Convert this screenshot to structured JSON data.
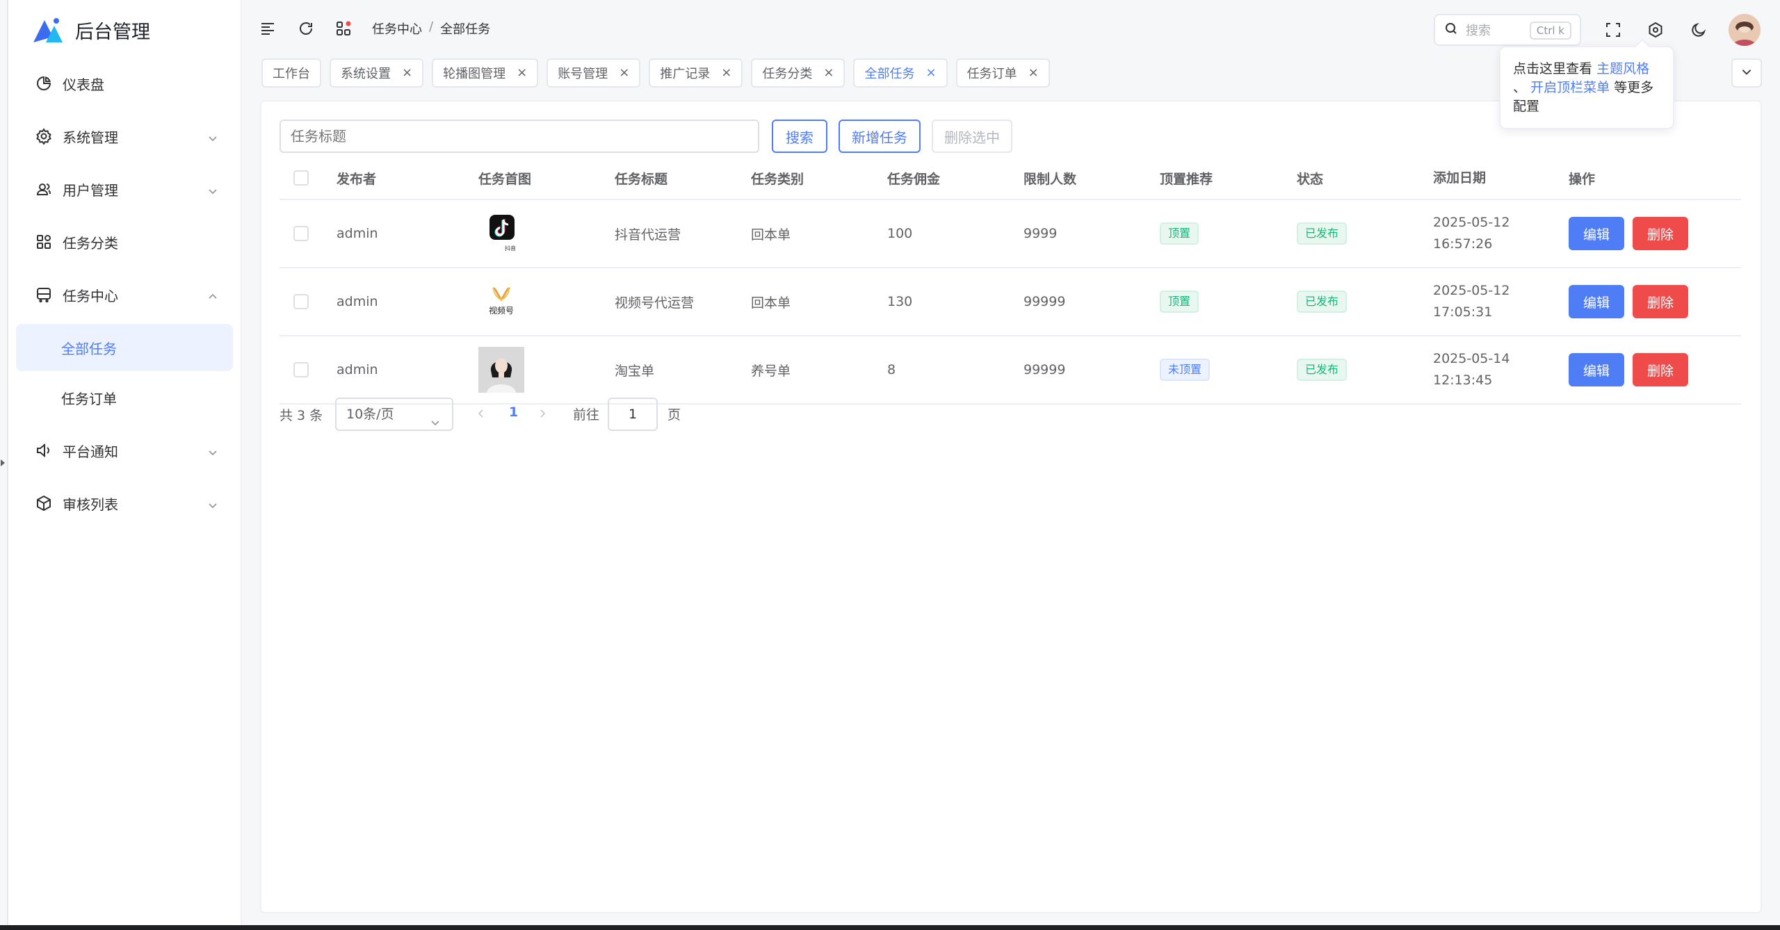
{
  "app": {
    "title": "后台管理"
  },
  "sidebar": {
    "items": [
      {
        "label": "仪表盘",
        "icon": "pie-chart-icon"
      },
      {
        "label": "系统管理",
        "icon": "gear-icon"
      },
      {
        "label": "用户管理",
        "icon": "users-icon"
      },
      {
        "label": "任务分类",
        "icon": "grid-icon"
      },
      {
        "label": "任务中心",
        "icon": "bus-icon"
      },
      {
        "label": "平台通知",
        "icon": "speaker-icon"
      },
      {
        "label": "审核列表",
        "icon": "box-icon"
      }
    ],
    "subitems": [
      {
        "label": "全部任务",
        "active": true
      },
      {
        "label": "任务订单",
        "active": false
      }
    ]
  },
  "header": {
    "breadcrumb": [
      "任务中心",
      "全部任务"
    ],
    "search_placeholder": "搜索",
    "search_shortcut": "Ctrl k"
  },
  "tabs": [
    {
      "label": "工作台",
      "closable": false
    },
    {
      "label": "系统设置",
      "closable": true
    },
    {
      "label": "轮播图管理",
      "closable": true
    },
    {
      "label": "账号管理",
      "closable": true
    },
    {
      "label": "推广记录",
      "closable": true
    },
    {
      "label": "任务分类",
      "closable": true
    },
    {
      "label": "全部任务",
      "closable": true,
      "active": true
    },
    {
      "label": "任务订单",
      "closable": true
    }
  ],
  "tooltip": {
    "text_before": "点击这里查看",
    "link1": "主题风格",
    "text_mid": "、",
    "link2": "开启顶栏菜单",
    "text_after": "等更多配置"
  },
  "toolbar": {
    "search_placeholder": "任务标题",
    "search_label": "搜索",
    "add_label": "新增任务",
    "delete_label": "删除选中"
  },
  "table": {
    "headers": [
      "发布者",
      "任务首图",
      "任务标题",
      "任务类别",
      "任务佣金",
      "限制人数",
      "顶置推荐",
      "状态",
      "添加日期",
      "操作"
    ],
    "rows": [
      {
        "publisher": "admin",
        "image": "tiktok-logo",
        "image_caption": "抖音",
        "title": "抖音代运营",
        "category": "回本单",
        "commission": "100",
        "limit": "9999",
        "pin": "顶置",
        "status": "已发布",
        "date": "2025-05-12",
        "time": "16:57:26"
      },
      {
        "publisher": "admin",
        "image": "channels-logo",
        "image_caption": "视频号",
        "title": "视频号代运营",
        "category": "回本单",
        "commission": "130",
        "limit": "99999",
        "pin": "顶置",
        "status": "已发布",
        "date": "2025-05-12",
        "time": "17:05:31"
      },
      {
        "publisher": "admin",
        "image": "portrait-photo",
        "image_caption": "",
        "title": "淘宝单",
        "category": "养号单",
        "commission": "8",
        "limit": "99999",
        "pin": "未顶置",
        "status": "已发布",
        "date": "2025-05-14",
        "time": "12:13:45"
      }
    ],
    "edit_label": "编辑",
    "delete_label": "删除"
  },
  "pagination": {
    "total_text": "共 3 条",
    "page_size": "10条/页",
    "current_page": "1",
    "goto_label": "前往",
    "goto_value": "1",
    "page_unit": "页"
  },
  "colors": {
    "primary": "#4f7df5",
    "danger": "#f04b4b",
    "success": "#1bb37a"
  }
}
